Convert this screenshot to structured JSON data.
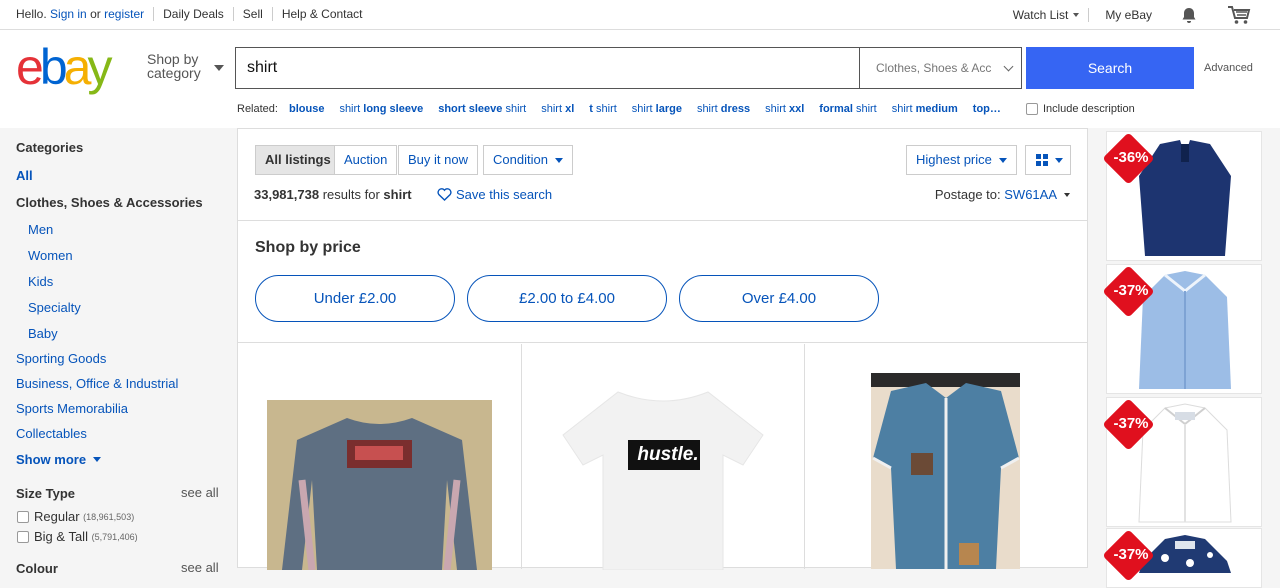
{
  "topbar": {
    "hello": "Hello.",
    "sign_in": "Sign in",
    "or": "or",
    "register": "register",
    "daily_deals": "Daily Deals",
    "sell": "Sell",
    "help": "Help & Contact",
    "watch_list": "Watch List",
    "my_ebay": "My eBay"
  },
  "header": {
    "logo_e": "e",
    "logo_b": "b",
    "logo_a": "a",
    "logo_y": "y",
    "shop_by_line1": "Shop by",
    "shop_by_line2": "category",
    "search_value": "shirt",
    "category_select": "Clothes, Shoes & Acc",
    "search_button": "Search",
    "advanced": "Advanced",
    "related_label": "Related:",
    "related": [
      {
        "pre": "",
        "bold": "blouse",
        "post": ""
      },
      {
        "pre": "shirt ",
        "bold": "long sleeve",
        "post": ""
      },
      {
        "pre": "",
        "bold": "short sleeve",
        "post": " shirt"
      },
      {
        "pre": "shirt ",
        "bold": "xl",
        "post": ""
      },
      {
        "pre": "",
        "bold": "t",
        "post": " shirt"
      },
      {
        "pre": "shirt ",
        "bold": "large",
        "post": ""
      },
      {
        "pre": "shirt ",
        "bold": "dress",
        "post": ""
      },
      {
        "pre": "shirt ",
        "bold": "xxl",
        "post": ""
      },
      {
        "pre": "",
        "bold": "formal",
        "post": " shirt"
      },
      {
        "pre": "shirt ",
        "bold": "medium",
        "post": ""
      },
      {
        "pre": "",
        "bold": "top…",
        "post": ""
      }
    ],
    "include_description": "Include description"
  },
  "sidebar": {
    "categories_heading": "Categories",
    "all": "All",
    "current_category": "Clothes, Shoes & Accessories",
    "subcategories": [
      "Men",
      "Women",
      "Kids",
      "Specialty",
      "Baby"
    ],
    "other_categories": [
      "Sporting Goods",
      "Business, Office & Industrial",
      "Sports Memorabilia",
      "Collectables"
    ],
    "show_more": "Show more",
    "size_type_heading": "Size Type",
    "see_all": "see all",
    "size_types": [
      {
        "label": "Regular",
        "count": "(18,961,503)"
      },
      {
        "label": "Big & Tall",
        "count": "(5,791,406)"
      }
    ],
    "next_heading_partial": "Colour",
    "next_see_all": "see all"
  },
  "main": {
    "tabs": [
      "All listings",
      "Auction",
      "Buy it now"
    ],
    "condition": "Condition",
    "sort": "Highest price",
    "result_count": "33,981,738",
    "results_for": "results for",
    "query": "shirt",
    "save_search": "Save this search",
    "postage_label": "Postage to:",
    "postage_value": "SW61AA",
    "shop_by_price": "Shop by price",
    "price_buckets": [
      "Under £2.00",
      "£2.00 to £4.00",
      "Over £4.00"
    ],
    "tile2_text": "hustle."
  },
  "ads": {
    "badges": [
      "-36%",
      "-37%",
      "-37%",
      "-37%"
    ]
  },
  "colors": {
    "accent": "#3665f3",
    "link": "#0654ba",
    "badge_red": "#e0101e"
  }
}
